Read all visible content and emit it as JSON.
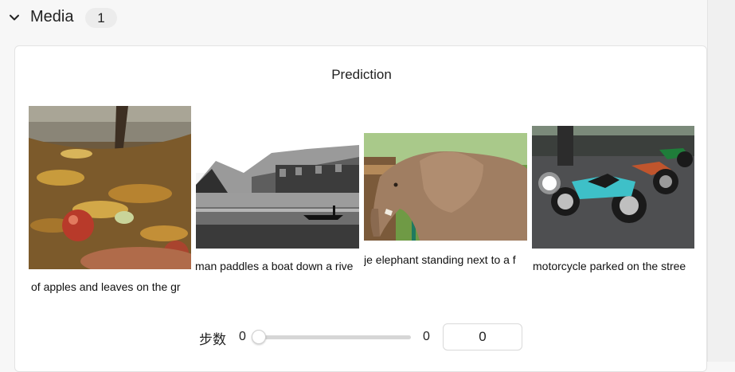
{
  "section": {
    "title": "Media",
    "count": "1"
  },
  "panel": {
    "title": "Prediction"
  },
  "gallery": {
    "items": [
      {
        "caption": "of apples and leaves on the gr",
        "icon": "apples-leaves-photo"
      },
      {
        "caption": "man paddles a boat down a rive",
        "icon": "river-boat-photo"
      },
      {
        "caption": "je elephant standing next to a f",
        "icon": "elephant-photo"
      },
      {
        "caption": "motorcycle parked on the stree",
        "icon": "motorcycle-photo"
      }
    ]
  },
  "step": {
    "label": "步数",
    "min": "0",
    "max": "0",
    "value": "0"
  },
  "colors": {
    "accent": "#d6d6d6",
    "card_border": "#e3e3e3"
  }
}
